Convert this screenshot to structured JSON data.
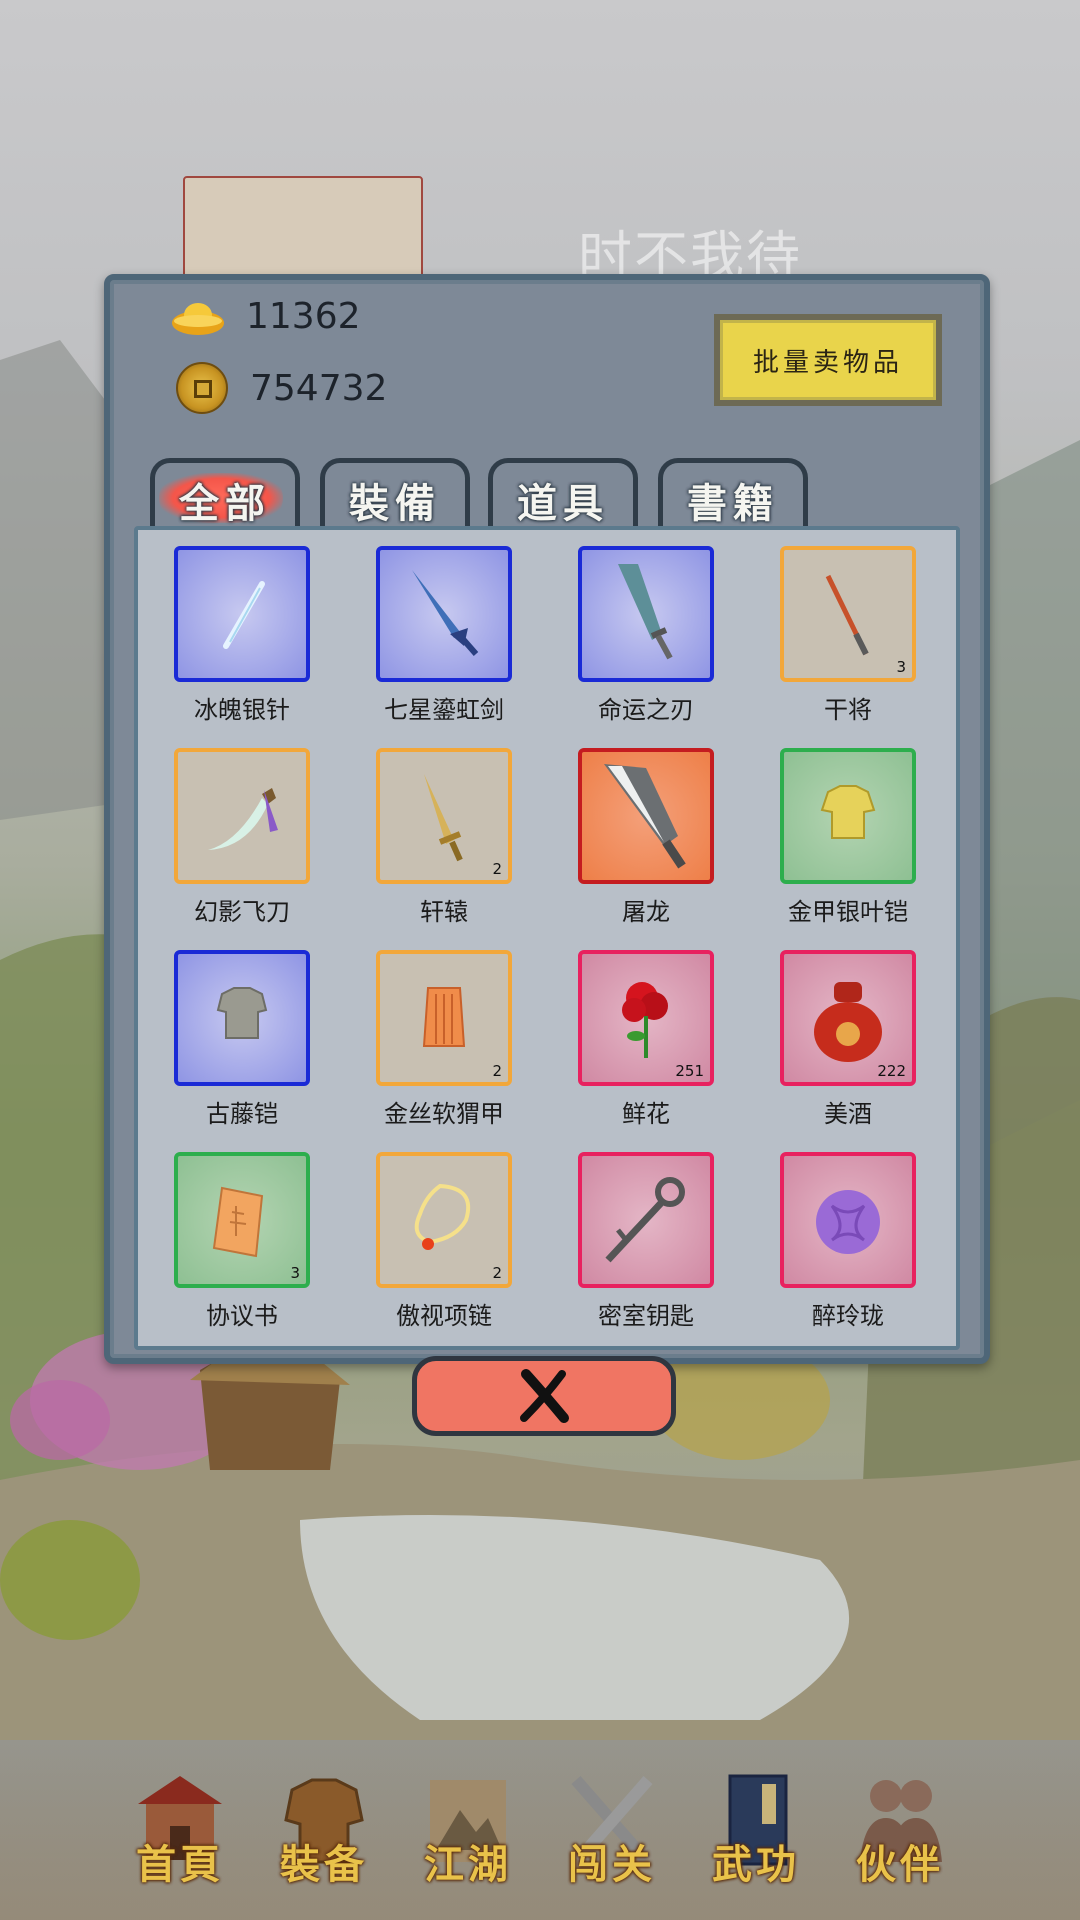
{
  "background": {
    "motto": "时不我待"
  },
  "currency": {
    "gold": "11362",
    "coins": "754732"
  },
  "sell_button": "批量卖物品",
  "tabs": [
    {
      "label": "全部",
      "active": true
    },
    {
      "label": "裝備",
      "active": false
    },
    {
      "label": "道具",
      "active": false
    },
    {
      "label": "書籍",
      "active": false
    }
  ],
  "items": [
    {
      "name": "冰魄银针",
      "count": "",
      "quality": "blue",
      "icon": "needle-icon"
    },
    {
      "name": "七星鎏虹剑",
      "count": "",
      "quality": "blue",
      "icon": "sword-icon"
    },
    {
      "name": "命运之刃",
      "count": "",
      "quality": "blue",
      "icon": "blade-icon"
    },
    {
      "name": "干将",
      "count": "3",
      "quality": "orange",
      "icon": "thin-sword-icon"
    },
    {
      "name": "幻影飞刀",
      "count": "",
      "quality": "orange",
      "icon": "flying-knife-icon"
    },
    {
      "name": "轩辕",
      "count": "2",
      "quality": "orange",
      "icon": "golden-sword-icon"
    },
    {
      "name": "屠龙",
      "count": "",
      "quality": "red-fill",
      "icon": "dragon-saber-icon"
    },
    {
      "name": "金甲银叶铠",
      "count": "",
      "quality": "green",
      "icon": "gold-armor-icon"
    },
    {
      "name": "古藤铠",
      "count": "",
      "quality": "blue",
      "icon": "vine-armor-icon"
    },
    {
      "name": "金丝软猬甲",
      "count": "2",
      "quality": "orange",
      "icon": "silk-armor-icon"
    },
    {
      "name": "鲜花",
      "count": "251",
      "quality": "red",
      "icon": "rose-icon"
    },
    {
      "name": "美酒",
      "count": "222",
      "quality": "red",
      "icon": "wine-jar-icon"
    },
    {
      "name": "协议书",
      "count": "3",
      "quality": "green",
      "icon": "scroll-icon"
    },
    {
      "name": "傲视项链",
      "count": "2",
      "quality": "orange",
      "icon": "necklace-icon"
    },
    {
      "name": "密室钥匙",
      "count": "",
      "quality": "red",
      "icon": "key-icon"
    },
    {
      "name": "醉玲珑",
      "count": "",
      "quality": "red",
      "icon": "purple-orb-icon"
    }
  ],
  "bottom_nav": [
    {
      "label": "首頁",
      "icon": "house-icon"
    },
    {
      "label": "裝备",
      "icon": "armor-icon"
    },
    {
      "label": "江湖",
      "icon": "mountain-scroll-icon"
    },
    {
      "label": "闯关",
      "icon": "crossed-swords-icon"
    },
    {
      "label": "武功",
      "icon": "book-icon"
    },
    {
      "label": "伙伴",
      "icon": "partners-icon"
    }
  ],
  "colors": {
    "quality_blue": "#1a2ad6",
    "quality_orange": "#f2a73a",
    "quality_green": "#2dae4d",
    "quality_red": "#e8215f",
    "sell_button": "#e9d44b",
    "close_button": "#f07563"
  }
}
